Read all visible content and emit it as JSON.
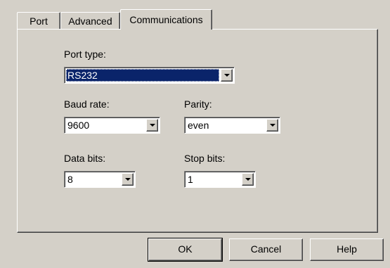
{
  "tabs": [
    {
      "label": "Port",
      "active": false
    },
    {
      "label": "Advanced",
      "active": false
    },
    {
      "label": "Communications",
      "active": true
    }
  ],
  "communications": {
    "port_type": {
      "label": "Port type:",
      "value": "RS232"
    },
    "baud_rate": {
      "label": "Baud rate:",
      "value": "9600"
    },
    "parity": {
      "label": "Parity:",
      "value": "even"
    },
    "data_bits": {
      "label": "Data bits:",
      "value": "8"
    },
    "stop_bits": {
      "label": "Stop bits:",
      "value": "1"
    }
  },
  "buttons": {
    "ok": "OK",
    "cancel": "Cancel",
    "help": "Help"
  },
  "colors": {
    "face": "#d4d0c8",
    "highlight": "#0a246a",
    "field": "#ffffff"
  }
}
